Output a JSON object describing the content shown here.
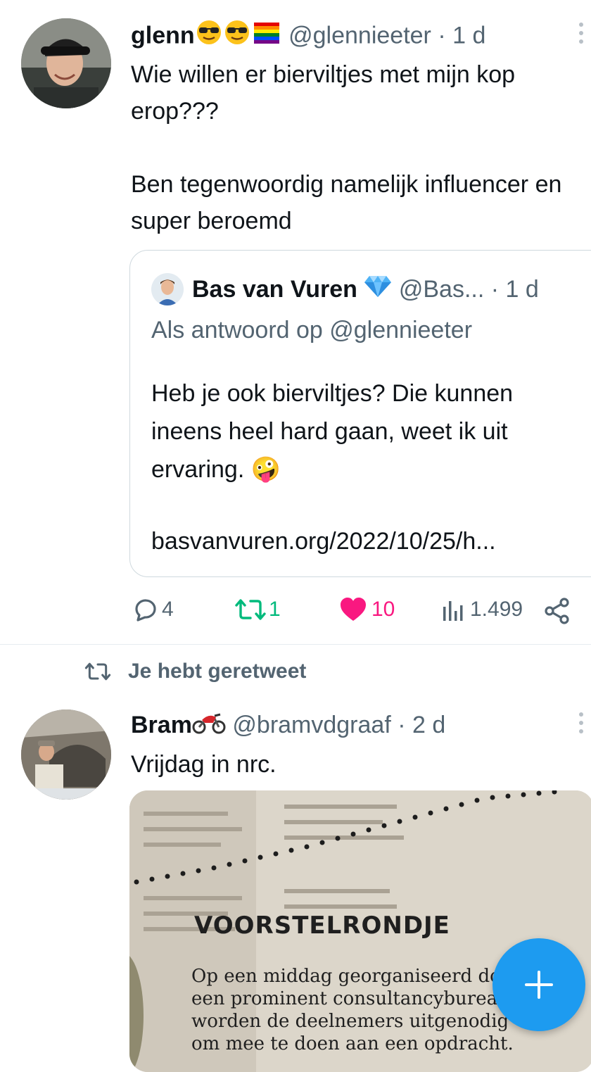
{
  "tweet1": {
    "name": "glenn",
    "handle": "@glennieeter",
    "time": "1 d",
    "text": "Wie willen er bierviltjes met mijn kop erop???\n\nBen tegenwoordig namelijk influencer en super beroemd",
    "quote": {
      "name": "Bas van Vuren",
      "handle": "@Bas...",
      "time": "1 d",
      "reply_to": "Als antwoord op @glennieeter",
      "text": "Heb je ook bierviltjes? Die kunnen ineens heel hard gaan, weet ik uit ervaring. 🤪",
      "link": "basvanvuren.org/2022/10/25/h..."
    },
    "actions": {
      "replies": "4",
      "retweets": "1",
      "likes": "10",
      "views": "1.499"
    }
  },
  "retweet_label": "Je hebt geretweet",
  "tweet2": {
    "name": "Bram",
    "handle": "@bramvdgraaf",
    "time": "2 d",
    "text": "Vrijdag in nrc.",
    "photo": {
      "heading": "VOORSTELRONDJE",
      "lines": [
        "Op een middag georganiseerd do",
        "een prominent consultancyburea",
        "worden de deelnemers uitgenodig",
        "om mee te doen aan een opdracht."
      ]
    }
  },
  "colors": {
    "accent": "#1d9bf0",
    "retweet": "#00ba7c",
    "like": "#f91880",
    "muted": "#536471"
  }
}
